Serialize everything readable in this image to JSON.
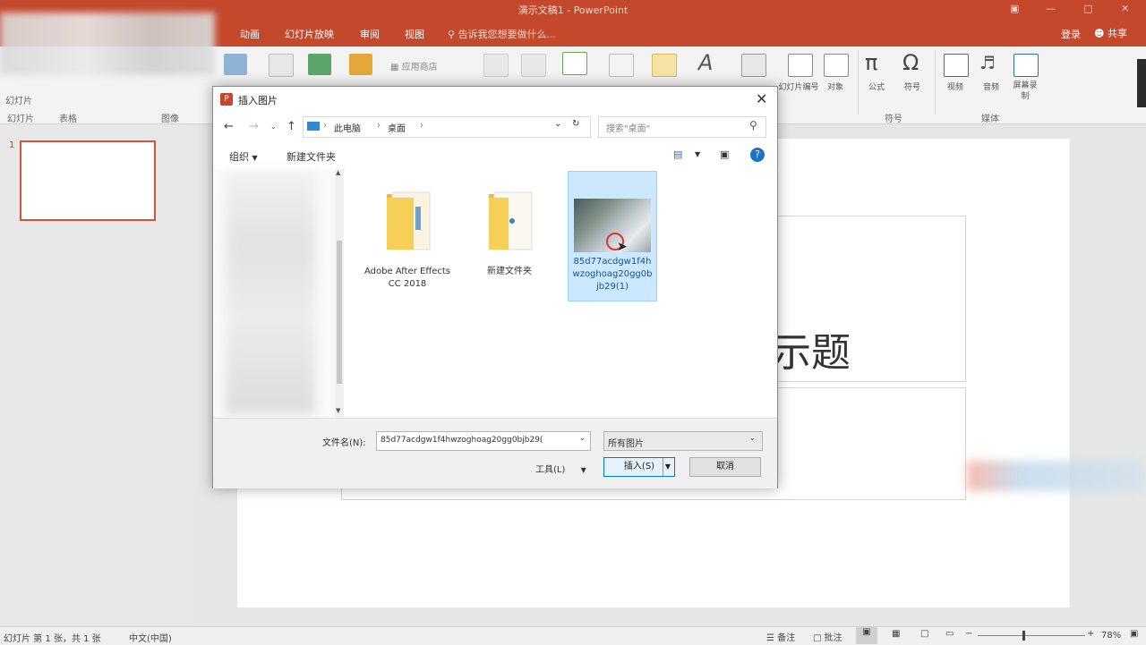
{
  "app": {
    "window_title": "演示文稿1 - PowerPoint",
    "tabs": [
      "动画",
      "幻灯片放映",
      "审阅",
      "视图"
    ],
    "tell_me": "告诉我您想要做什么...",
    "login": "登录",
    "share": "共享"
  },
  "ribbon": {
    "left_labels": [
      "幻灯片",
      "表格",
      "图像"
    ],
    "group_symbols": "符号",
    "group_media": "媒体",
    "addin_store": "应用商店",
    "items": {
      "slide_number": "幻灯片编号",
      "object": "对象",
      "equation": "公式",
      "symbol": "符号",
      "video": "视频",
      "audio": "音频",
      "screen_recording": "屏幕录制"
    }
  },
  "slide": {
    "number": "1",
    "title_partial": "示题"
  },
  "dialog": {
    "title": "插入图片",
    "breadcrumb": [
      "此电脑",
      "桌面"
    ],
    "search_placeholder": "搜索\"桌面\"",
    "organize": "组织",
    "new_folder": "新建文件夹",
    "files": [
      {
        "name": "Adobe After Effects CC 2018",
        "type": "folder"
      },
      {
        "name": "新建文件夹",
        "type": "folder"
      },
      {
        "name": "85d77acdgw1f4hwzoghoag20gg0bjb29(1)",
        "type": "image",
        "selected": true
      }
    ],
    "filename_label": "文件名(N):",
    "filename_value": "85d77acdgw1f4hwzoghoag20gg0bjb29(",
    "filetype_value": "所有图片",
    "tools": "工具(L)",
    "insert": "插入(S)",
    "cancel": "取消"
  },
  "statusbar": {
    "slide_info": "幻灯片 第 1 张，共 1 张",
    "language": "中文(中国)",
    "notes": "备注",
    "comments": "批注",
    "zoom": "78%"
  },
  "colors": {
    "accent": "#c4482c",
    "selection": "#cce8ff",
    "folder": "#f5cf57"
  }
}
